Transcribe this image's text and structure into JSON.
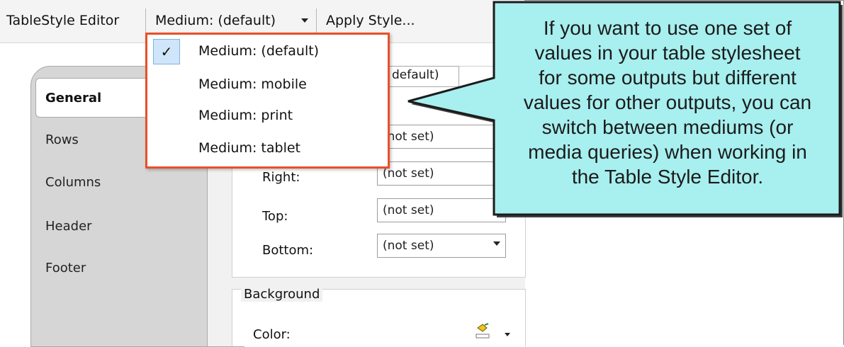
{
  "toolbar": {
    "title": "TableStyle Editor",
    "medium_selector": "Medium: (default)",
    "apply_style": "Apply Style..."
  },
  "medium_menu": {
    "items": [
      {
        "label": "Medium: (default)",
        "checked": true
      },
      {
        "label": "Medium: mobile",
        "checked": false
      },
      {
        "label": "Medium: print",
        "checked": false
      },
      {
        "label": "Medium: tablet",
        "checked": false
      }
    ],
    "check_glyph": "✓"
  },
  "tabs": {
    "general": "General",
    "rows": "Rows",
    "columns": "Columns",
    "header": "Header",
    "footer": "Footer"
  },
  "partial_chip": "default)",
  "fields": {
    "left": {
      "value": "(not set)"
    },
    "right": {
      "label": "Right:",
      "value": "(not set)"
    },
    "top": {
      "label": "Top:",
      "value": "(not set)"
    },
    "bottom": {
      "label": "Bottom:",
      "value": "(not set)"
    }
  },
  "background": {
    "legend": "Background",
    "color_label": "Color:"
  },
  "callout": {
    "lines": [
      "If you want to use one set of",
      "values in your table stylesheet",
      "for some outputs but different",
      "values for other outputs, you can",
      "switch between mediums (or",
      "media queries) when working in",
      "the Table Style Editor."
    ]
  },
  "colors": {
    "callout_fill": "#a8efef",
    "callout_stroke": "#1b1b1b",
    "menu_border": "#e8502a",
    "check_bg": "#cfe5f9"
  }
}
